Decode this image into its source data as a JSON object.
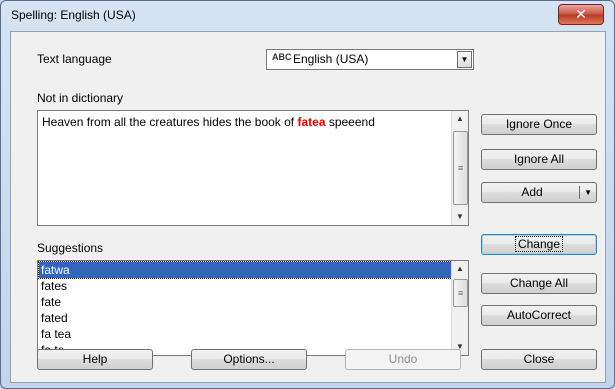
{
  "window": {
    "title": "Spelling: English (USA)"
  },
  "language": {
    "label": "Text language",
    "value": "English (USA)",
    "spell_icon": "ABC"
  },
  "not_in_dictionary": {
    "label": "Not in dictionary",
    "text_before": "Heaven from all the creatures hides the book of ",
    "misspelled_word": "fatea",
    "text_after": " speeend"
  },
  "suggestions": {
    "label": "Suggestions",
    "items": [
      "fatwa",
      "fates",
      "fate",
      "fated",
      "fa tea",
      "fa te"
    ],
    "selected": "fatwa"
  },
  "buttons": {
    "ignore_once": "Ignore Once",
    "ignore_all": "Ignore All",
    "add": "Add",
    "change": "Change",
    "change_all": "Change All",
    "autocorrect": "AutoCorrect",
    "help": "Help",
    "options": "Options...",
    "undo": "Undo",
    "close": "Close"
  },
  "colors": {
    "misspelled": "#e00000",
    "selection": "#3366bb"
  }
}
